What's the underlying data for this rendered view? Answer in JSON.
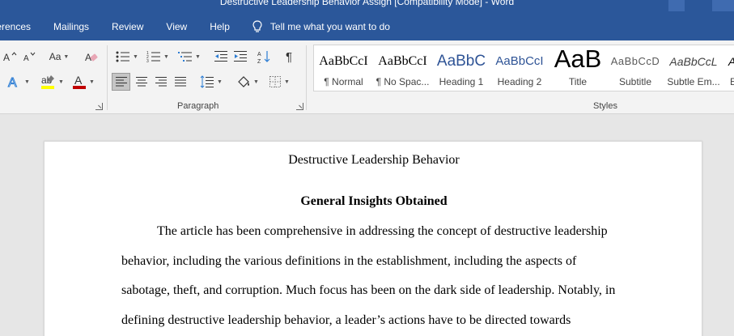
{
  "window": {
    "title": "Destructive Leadership Behavior Assign [Compatibility Mode] - Word"
  },
  "menu": {
    "tabs": [
      "ferences",
      "Mailings",
      "Review",
      "View",
      "Help"
    ],
    "tell_me": "Tell me what you want to do"
  },
  "ribbon": {
    "font": {
      "change_case": "Aa"
    },
    "groups": {
      "paragraph": "Paragraph",
      "styles": "Styles"
    },
    "styles": [
      {
        "preview": "AaBbCcI",
        "name": "¶ Normal"
      },
      {
        "preview": "AaBbCcI",
        "name": "¶ No Spac..."
      },
      {
        "preview": "AaBbC",
        "name": "Heading 1"
      },
      {
        "preview": "AaBbCcI",
        "name": "Heading 2"
      },
      {
        "preview": "AaB",
        "name": "Title"
      },
      {
        "preview": "AaBbCcD",
        "name": "Subtitle"
      },
      {
        "preview": "AaBbCcL",
        "name": "Subtle Em..."
      },
      {
        "preview": "A",
        "name": "E"
      }
    ],
    "colors": {
      "highlight": "#ffff00",
      "font_color": "#c00000",
      "accent": "#2b579a"
    }
  },
  "document": {
    "title": "Destructive Leadership Behavior",
    "heading": "General Insights Obtained",
    "lines": [
      "The article has been comprehensive in addressing the concept of destructive leadership",
      "behavior, including the various definitions in the establishment, including the aspects of",
      "sabotage, theft, and corruption. Much focus has been on the dark side of leadership. Notably, in",
      "defining destructive leadership behavior, a leader’s actions have to be directed towards"
    ]
  }
}
